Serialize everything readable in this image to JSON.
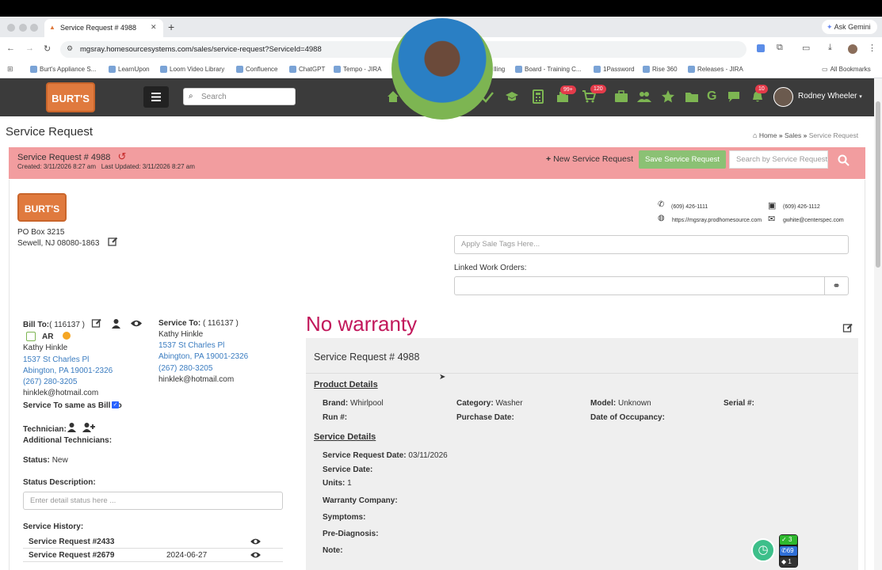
{
  "browser": {
    "tab_title": "Service Request # 4988",
    "url": "mgsray.homesourcesystems.com/sales/service-request?ServiceId=4988",
    "ask_label": "Ask Gemini",
    "bookmarks": [
      "Burt's Appliance S...",
      "LearnUpon",
      "Loom Video Library",
      "Confluence",
      "ChatGPT",
      "Tempo - JIRA",
      "lling",
      "Board - Training C...",
      "1Password",
      "Rise 360",
      "Releases - JIRA"
    ],
    "all_bookmarks": "All Bookmarks"
  },
  "nav": {
    "logo_text": "BURT'S",
    "search_placeholder": "Search",
    "badge_cart1": "99+",
    "badge_cart2": "120",
    "badge_bell": "10",
    "user_name": "Rodney Wheeler"
  },
  "page": {
    "title": "Service Request",
    "breadcrumb": [
      "Home",
      "Sales",
      "Service Request"
    ]
  },
  "request": {
    "title": "Service Request # 4988",
    "created": "Created: 3/11/2026 8:27 am",
    "updated": "Last Updated: 3/11/2026 8:27 am",
    "new_label": "New Service Request",
    "save_label": "Save Service Request",
    "search_placeholder": "Search by Service Request"
  },
  "company": {
    "logo_text": "BURT'S",
    "address1": "PO Box 3215",
    "address2": "Sewell, NJ 08080-1863",
    "phone": "(609) 426-1111",
    "fax": "(609) 426-1112",
    "website": "https://mgsray.prodhomesource.com",
    "email": "gwhite@centerspec.com",
    "tags_placeholder": "Apply Sale Tags Here...",
    "linked_label": "Linked Work Orders:"
  },
  "bill_to": {
    "label": "Bill To:",
    "id": "( 116137 )",
    "ar": "AR",
    "name": "Kathy Hinkle",
    "street": "1537 St Charles Pl",
    "city": "Abington, PA 19001-2326",
    "phone": "(267) 280-3205",
    "email": "hinklek@hotmail.com",
    "same_label": "Service To same as Bill To"
  },
  "service_to": {
    "label": "Service To:",
    "id": "( 116137 )",
    "name": "Kathy Hinkle",
    "street": "1537 St Charles Pl",
    "city": "Abington, PA 19001-2326",
    "phone": "(267) 280-3205",
    "email": "hinklek@hotmail.com"
  },
  "left": {
    "technician": "Technician:",
    "additional": "Additional Technicians:",
    "status_label": "Status:",
    "status_value": "New",
    "status_desc_label": "Status Description:",
    "status_desc_placeholder": "Enter detail status here ...",
    "history_label": "Service History:",
    "history": [
      {
        "request": "Service Request #2433",
        "date": ""
      },
      {
        "request": "Service Request #2679",
        "date": "2024-06-27"
      }
    ]
  },
  "detail": {
    "warranty": "No warranty",
    "panel_title": "Service Request # 4988",
    "product_heading": "Product Details",
    "brand_label": "Brand:",
    "brand_value": "Whirlpool",
    "category_label": "Category:",
    "category_value": "Washer",
    "model_label": "Model:",
    "model_value": "Unknown",
    "serial_label": "Serial #:",
    "run_label": "Run #:",
    "purchase_label": "Purchase Date:",
    "occupancy_label": "Date of Occupancy:",
    "service_heading": "Service Details",
    "req_date_label": "Service Request Date:",
    "req_date_value": "03/11/2026",
    "service_date_label": "Service Date:",
    "units_label": "Units:",
    "units_value": "1",
    "warranty_co_label": "Warranty Company:",
    "symptoms_label": "Symptoms:",
    "prediag_label": "Pre-Diagnosis:",
    "note_label": "Note:"
  },
  "widget": {
    "check": "3",
    "phone": "69",
    "chat": "1"
  },
  "colors": {
    "nav": "#3b3b3b",
    "red_bar": "#f29d9f",
    "save": "#8bc174",
    "warranty": "#c2185b",
    "link": "#3a7cc0"
  }
}
